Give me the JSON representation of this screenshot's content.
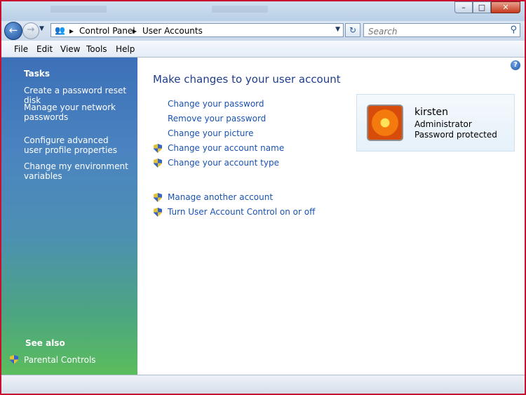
{
  "window": {
    "minimize": "0",
    "maximize": "1",
    "close": "r"
  },
  "nav": {
    "breadcrumb": [
      "Control Panel",
      "User Accounts"
    ],
    "search_placeholder": "Search"
  },
  "menu": [
    "File",
    "Edit",
    "View",
    "Tools",
    "Help"
  ],
  "sidebar": {
    "tasks_heading": "Tasks",
    "tasks": [
      "Create a password reset disk",
      "Manage your network passwords",
      "Configure advanced user profile properties",
      "Change my environment variables"
    ],
    "see_also_heading": "See also",
    "see_also": [
      "Parental Controls"
    ]
  },
  "main": {
    "heading": "Make changes to your user account",
    "tasks": [
      "Change your password",
      "Remove your password",
      "Change your picture",
      "Change your account name",
      "Change your account type",
      "Manage another account",
      "Turn User Account Control on or off"
    ]
  },
  "user": {
    "name": "kirsten",
    "role": "Administrator",
    "status": "Password protected"
  },
  "icons": {
    "back": "back-arrow-icon",
    "forward": "forward-arrow-icon",
    "search": "search-icon",
    "refresh": "refresh-icon",
    "help": "help-icon",
    "shield": "uac-shield-icon"
  },
  "colors": {
    "link": "#1a52b0",
    "heading": "#1e3d8f",
    "frame_border": "#c8102e"
  }
}
